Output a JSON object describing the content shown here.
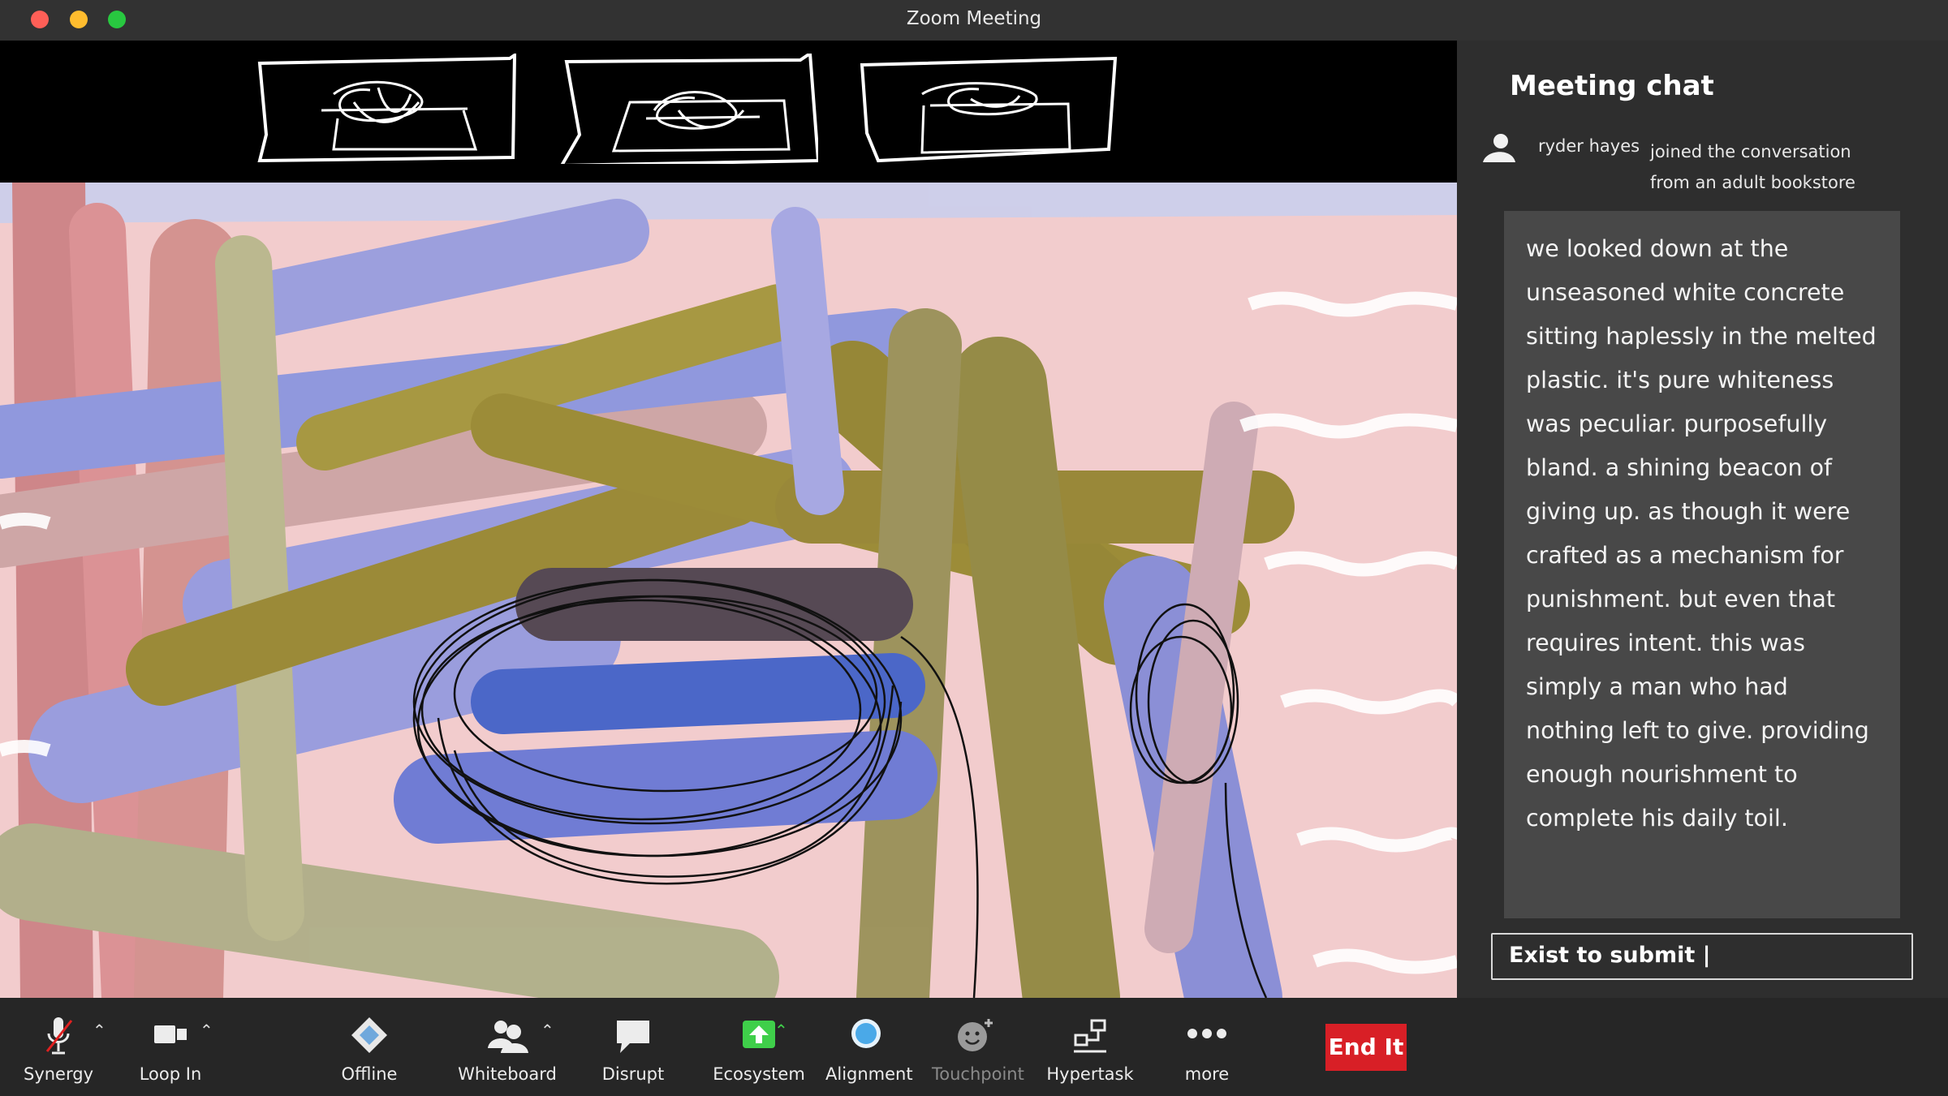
{
  "window": {
    "title": "Zoom Meeting"
  },
  "chat": {
    "title": "Meeting chat",
    "join_name": "ryder hayes",
    "join_text": "joined the conversation from an adult bookstore",
    "message": "we looked down at the unseasoned white concrete sitting haplessly in the melted plastic. it's pure whiteness was peculiar. purposefully bland. a shining beacon of giving up. as though it were crafted as a mechanism for punishment. but even that requires intent. this was simply a man who had nothing left to give. providing enough nourishment to complete his daily toil.",
    "input_value": "Exist to submit |"
  },
  "toolbar": {
    "synergy": "Synergy",
    "loop_in": "Loop In",
    "offline": "Offline",
    "whiteboard": "Whiteboard",
    "disrupt": "Disrupt",
    "ecosystem": "Ecosystem",
    "alignment": "Alignment",
    "touchpoint": "Touchpoint",
    "hypertask": "Hypertask",
    "more": "more",
    "end": "End It"
  },
  "colors": {
    "end_button": "#d81f26",
    "ecosystem_icon": "#3fcf4a",
    "alignment_icon": "#4aa9e8"
  }
}
